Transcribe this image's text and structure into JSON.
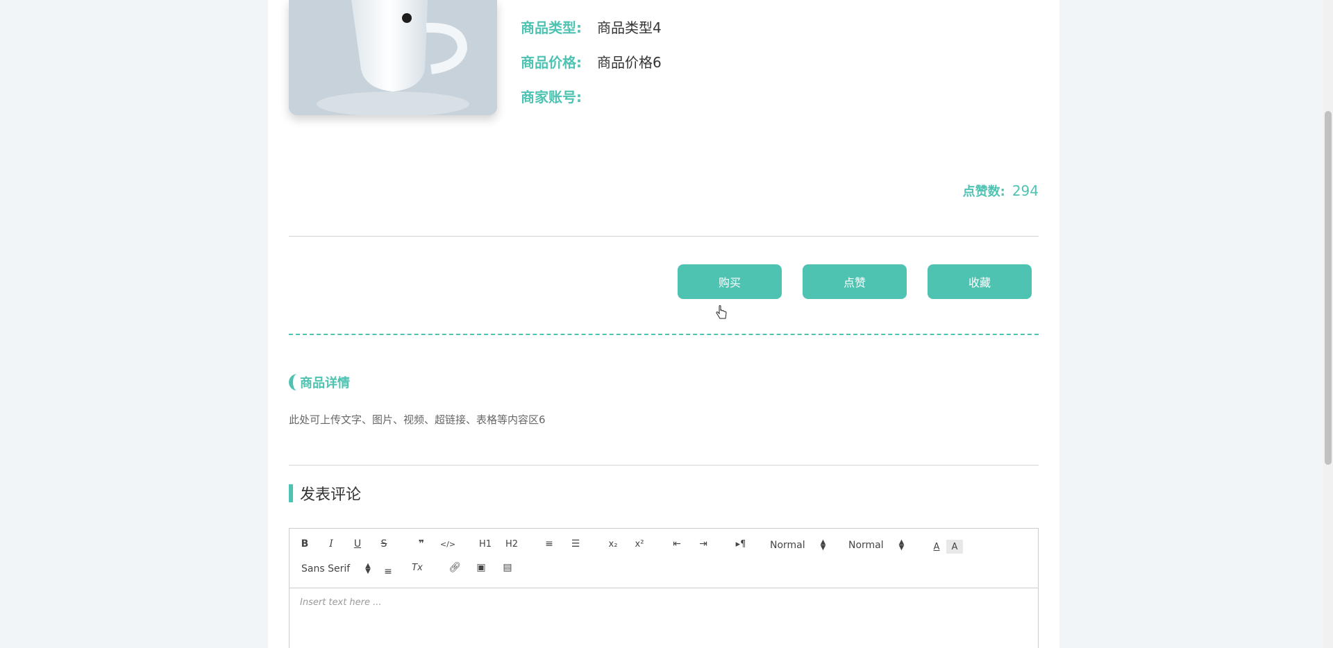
{
  "product": {
    "type_label": "商品类型:",
    "type_value": "商品类型4",
    "price_label": "商品价格:",
    "price_value": "商品价格6",
    "merchant_label": "商家账号:",
    "merchant_value": "",
    "likes_label": "点赞数:",
    "likes_value": "294"
  },
  "actions": {
    "buy_label": "购买",
    "like_label": "点赞",
    "favorite_label": "收藏"
  },
  "detail": {
    "title": "商品详情",
    "body": "此处可上传文字、图片、视频、超链接、表格等内容区6"
  },
  "comment": {
    "title": "发表评论",
    "placeholder": "Insert text here ...",
    "toolbar": {
      "size_picker": "Normal",
      "header_picker": "Normal",
      "font_picker": "Sans Serif",
      "h1": "H1",
      "h2": "H2"
    }
  },
  "colors": {
    "accent": "#4fc3b2",
    "background": "#f1f5f8"
  }
}
